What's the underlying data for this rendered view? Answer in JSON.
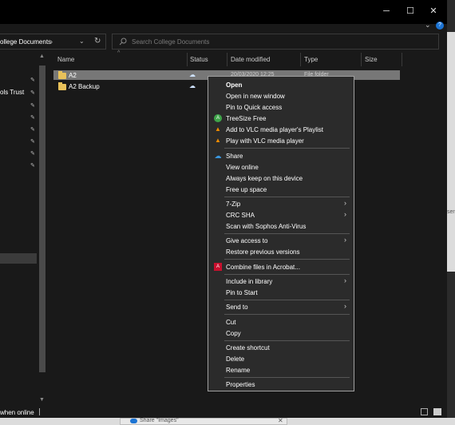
{
  "window": {
    "minimize": "─",
    "maximize": "☐",
    "close": "✕"
  },
  "help": "?",
  "chevron": "⌄",
  "address": {
    "path_fragment": "ollege Documents",
    "separator": "›",
    "dropdown": "⌄",
    "refresh": "↻"
  },
  "search": {
    "placeholder": "Search College Documents",
    "icon": "search-icon"
  },
  "nav": {
    "visible_item": "ols Trust",
    "pin_glyph": "📌"
  },
  "columns": {
    "name": "Name",
    "status": "Status",
    "date": "Date modified",
    "type": "Type",
    "size": "Size",
    "sort": "^"
  },
  "files": [
    {
      "name": "A2",
      "date": "20/03/2020 12:25",
      "type": "File folder"
    },
    {
      "name": "A2 Backup"
    }
  ],
  "menu": {
    "open": "Open",
    "open_new_window": "Open in new window",
    "pin_quick_access": "Pin to Quick access",
    "treesize": "TreeSize Free",
    "vlc_playlist": "Add to VLC media player's Playlist",
    "vlc_play": "Play with VLC media player",
    "share": "Share",
    "view_online": "View online",
    "always_keep": "Always keep on this device",
    "free_space": "Free up space",
    "zip": "7-Zip",
    "crc": "CRC SHA",
    "sophos": "Scan with Sophos Anti-Virus",
    "give_access": "Give access to",
    "restore_versions": "Restore previous versions",
    "combine_acrobat": "Combine files in Acrobat...",
    "include_library": "Include in library",
    "pin_start": "Pin to Start",
    "send_to": "Send to",
    "cut": "Cut",
    "copy": "Copy",
    "create_shortcut": "Create shortcut",
    "delete": "Delete",
    "rename": "Rename",
    "properties": "Properties",
    "submenu_arrow": "›"
  },
  "status": {
    "text": "when online"
  },
  "right_edge": "ser",
  "taskbar": {
    "button_text": "Share \"Images\"",
    "close": "✕"
  }
}
